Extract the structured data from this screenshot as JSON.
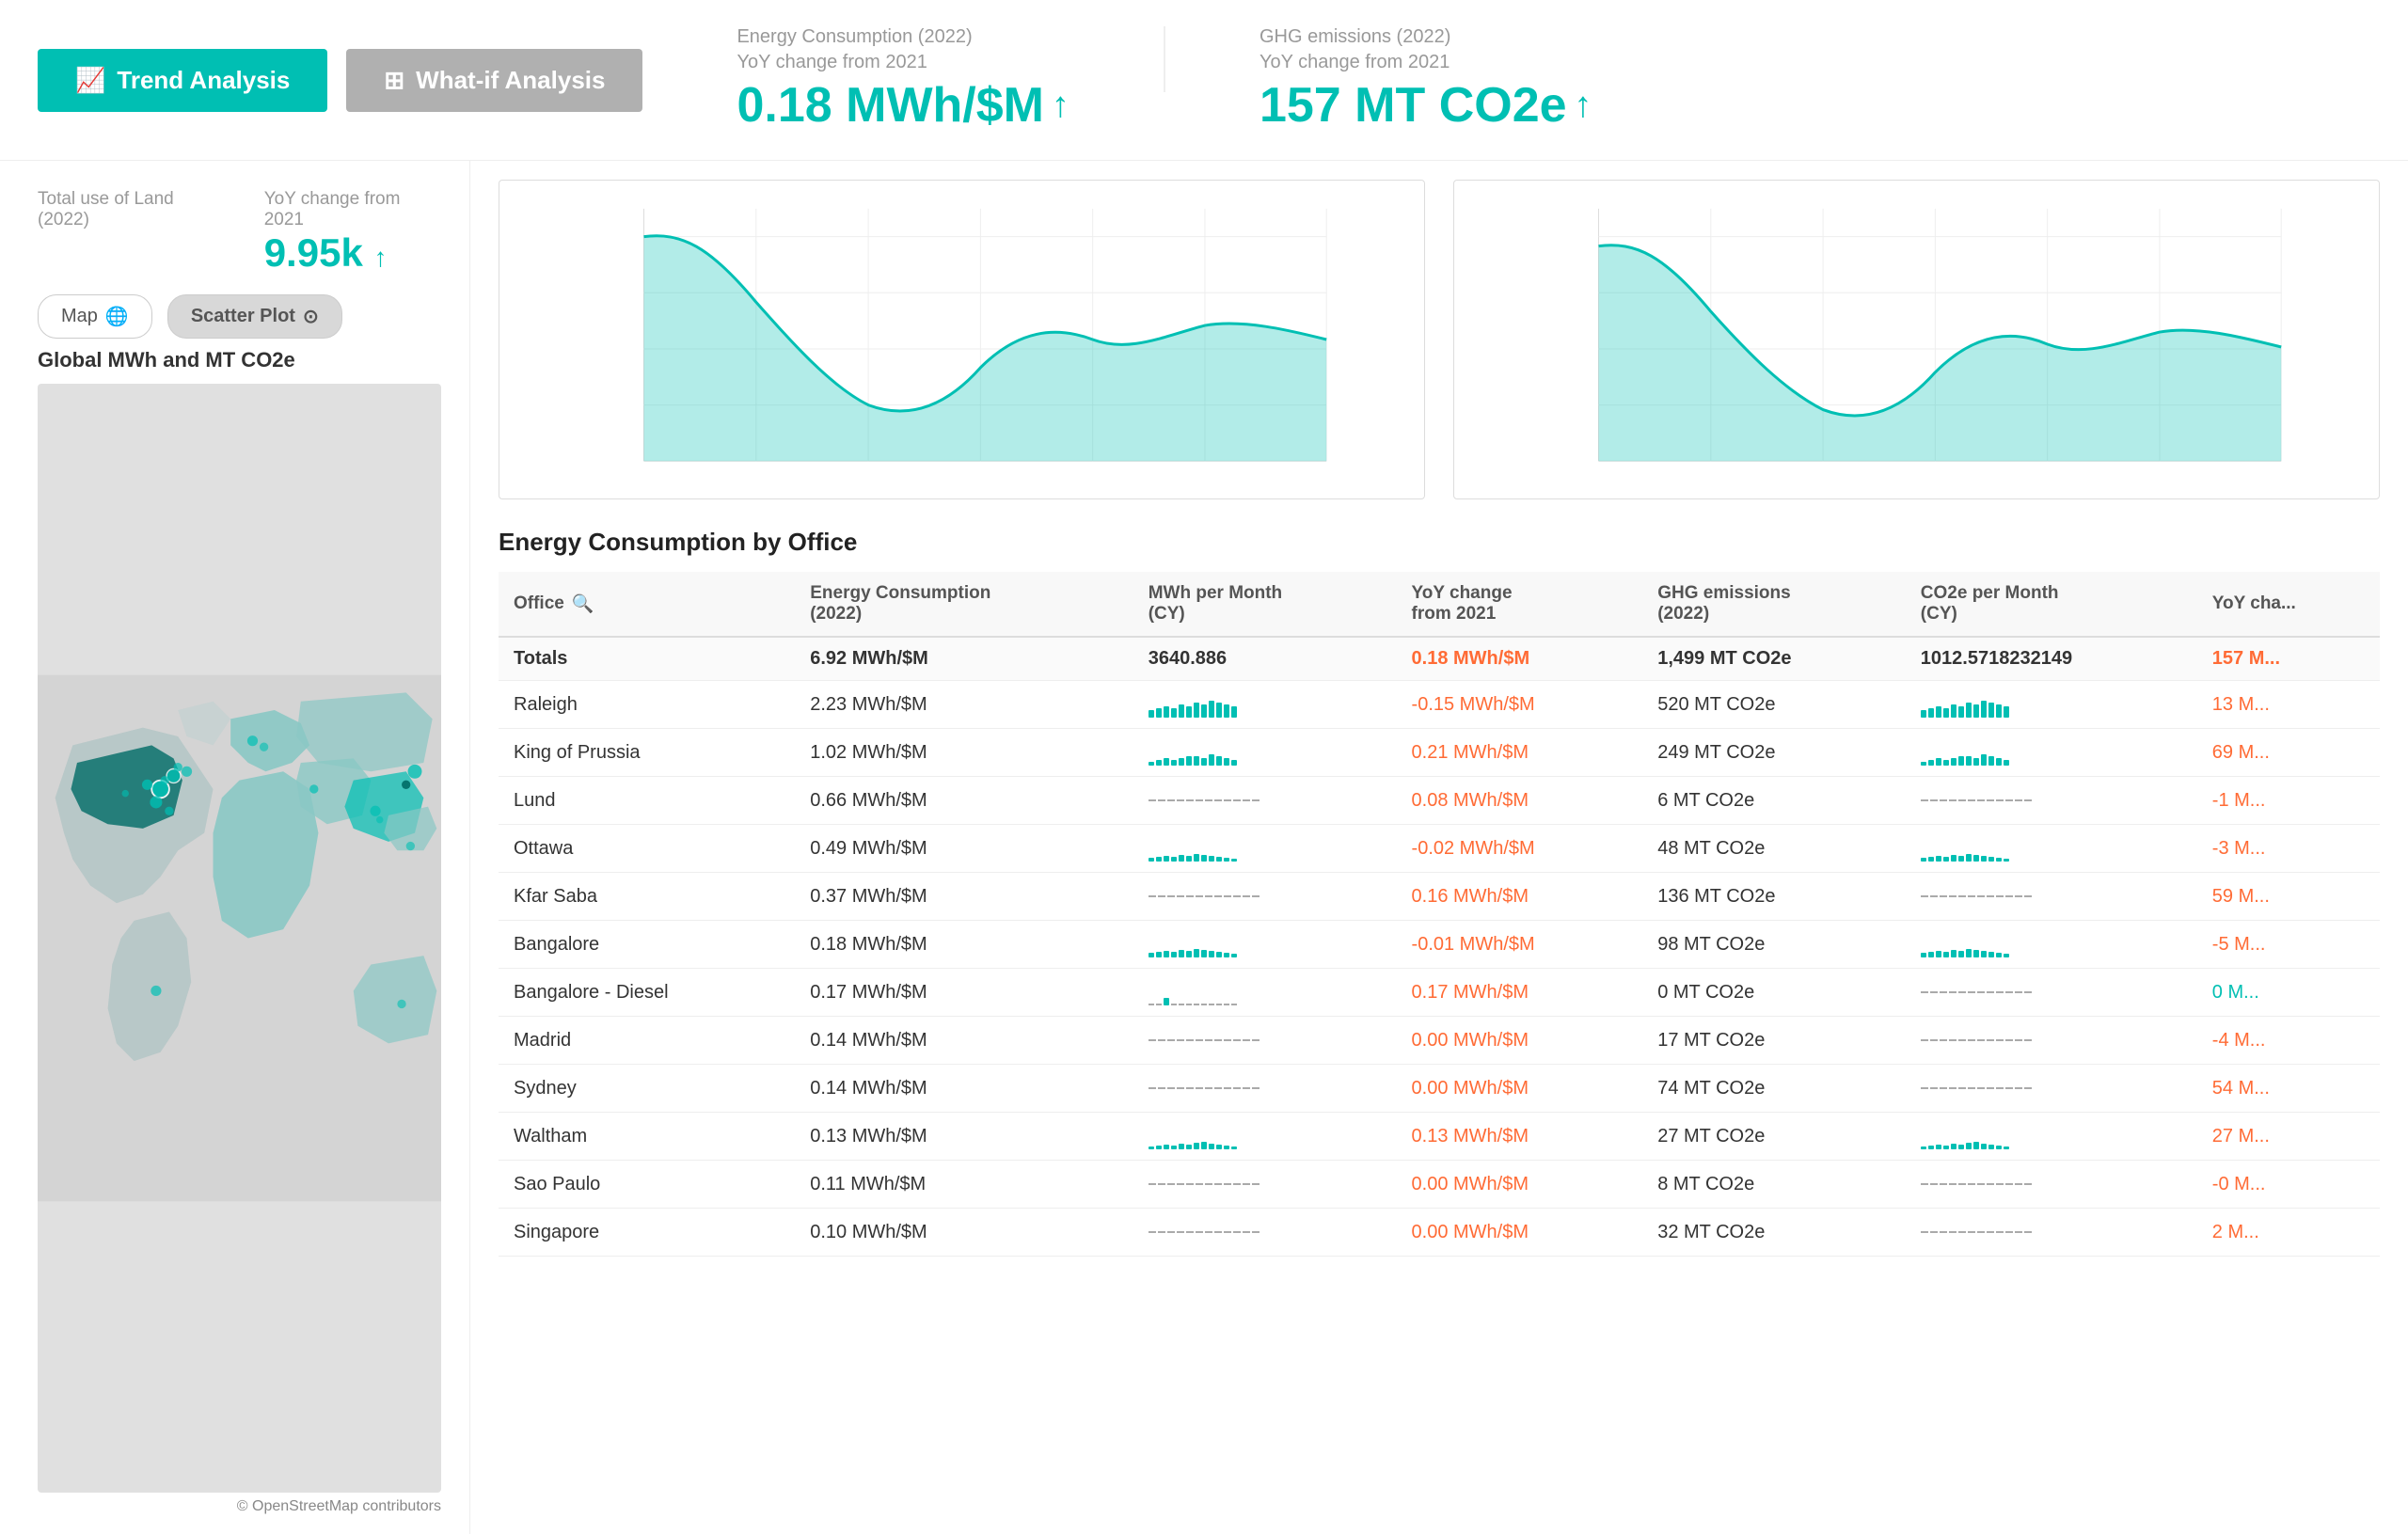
{
  "tabs": [
    {
      "id": "trend",
      "label": "Trend Analysis",
      "icon": "📈",
      "active": true
    },
    {
      "id": "whatif",
      "label": "What-if Analysis",
      "icon": "⊞",
      "active": false
    }
  ],
  "kpis": [
    {
      "label": "Energy Consumption (2022)",
      "sublabel": "YoY change from 2021",
      "value": "0.18 MWh/$M",
      "arrow": "↑"
    },
    {
      "label": "GHG emissions (2022)",
      "sublabel": "YoY change from 2021",
      "value": "157 MT CO2e",
      "arrow": "↑"
    }
  ],
  "land": {
    "label": "Total use of Land (2022)",
    "yoy_label": "YoY change from 2021",
    "value": "9.95k",
    "arrow": "↑"
  },
  "map": {
    "label": "Map",
    "scatter_label": "Scatter Plot",
    "chart_title": "Global MWh and MT CO2e",
    "credit": "© OpenStreetMap contributors"
  },
  "energy_table": {
    "title": "Energy Consumption by Office",
    "columns": [
      "Office",
      "",
      "Energy Consumption (2022)",
      "MWh per Month (CY)",
      "YoY change from 2021",
      "GHG emissions (2022)",
      "CO2e per Month (CY)",
      "YoY cha..."
    ],
    "totals": {
      "office": "Totals",
      "energy": "6.92 MWh/$M",
      "mwh_month": "3640.886",
      "yoy_energy": "0.18 MWh/$M",
      "ghg": "1,499 MT CO2e",
      "co2e_month": "1012.5718232149",
      "yoy_ghg": "157 M..."
    },
    "rows": [
      {
        "office": "Raleigh",
        "energy": "2.23 MWh/$M",
        "bar_type": "solid",
        "bar_heights": [
          8,
          10,
          12,
          10,
          14,
          12,
          16,
          14,
          18,
          16,
          14,
          12
        ],
        "yoy_energy": "-0.15 MWh/$M",
        "yoy_energy_color": "orange",
        "ghg": "520 MT CO2e",
        "bar2_type": "solid",
        "bar2_heights": [
          8,
          10,
          12,
          10,
          14,
          12,
          16,
          14,
          18,
          16,
          14,
          12
        ],
        "yoy_ghg": "13 M...",
        "yoy_ghg_color": "orange"
      },
      {
        "office": "King of Prussia",
        "energy": "1.02 MWh/$M",
        "bar_type": "solid",
        "bar_heights": [
          4,
          6,
          8,
          6,
          8,
          10,
          10,
          8,
          12,
          10,
          8,
          6
        ],
        "yoy_energy": "0.21 MWh/$M",
        "yoy_energy_color": "orange",
        "ghg": "249 MT CO2e",
        "bar2_type": "solid",
        "bar2_heights": [
          4,
          6,
          8,
          6,
          8,
          10,
          10,
          8,
          12,
          10,
          8,
          6
        ],
        "yoy_ghg": "69 M...",
        "yoy_ghg_color": "orange"
      },
      {
        "office": "Lund",
        "energy": "0.66 MWh/$M",
        "bar_type": "dashed",
        "yoy_energy": "0.08 MWh/$M",
        "yoy_energy_color": "orange",
        "ghg": "6 MT CO2e",
        "bar2_type": "dashed",
        "yoy_ghg": "-1 M...",
        "yoy_ghg_color": "orange"
      },
      {
        "office": "Ottawa",
        "energy": "0.49 MWh/$M",
        "bar_type": "solid",
        "bar_heights": [
          4,
          5,
          6,
          5,
          7,
          6,
          8,
          7,
          6,
          5,
          4,
          3
        ],
        "yoy_energy": "-0.02 MWh/$M",
        "yoy_energy_color": "orange",
        "ghg": "48 MT CO2e",
        "bar2_type": "solid",
        "bar2_heights": [
          4,
          5,
          6,
          5,
          7,
          6,
          8,
          7,
          6,
          5,
          4,
          3
        ],
        "yoy_ghg": "-3 M...",
        "yoy_ghg_color": "orange"
      },
      {
        "office": "Kfar Saba",
        "energy": "0.37 MWh/$M",
        "bar_type": "dashed",
        "yoy_energy": "0.16 MWh/$M",
        "yoy_energy_color": "orange",
        "ghg": "136 MT CO2e",
        "bar2_type": "dashed",
        "yoy_ghg": "59 M...",
        "yoy_ghg_color": "orange"
      },
      {
        "office": "Bangalore",
        "energy": "0.18 MWh/$M",
        "bar_type": "solid",
        "bar_heights": [
          5,
          6,
          7,
          6,
          8,
          7,
          9,
          8,
          7,
          6,
          5,
          4
        ],
        "yoy_energy": "-0.01 MWh/$M",
        "yoy_energy_color": "orange",
        "ghg": "98 MT CO2e",
        "bar2_type": "solid",
        "bar2_heights": [
          5,
          6,
          7,
          6,
          8,
          7,
          9,
          8,
          7,
          6,
          5,
          4
        ],
        "yoy_ghg": "-5 M...",
        "yoy_ghg_color": "orange"
      },
      {
        "office": "Bangalore - Diesel",
        "energy": "0.17 MWh/$M",
        "bar_type": "mixed",
        "bar_heights": [
          2,
          2,
          8,
          2,
          2,
          2,
          2,
          2,
          2,
          2,
          2,
          2
        ],
        "yoy_energy": "0.17 MWh/$M",
        "yoy_energy_color": "orange",
        "ghg": "0 MT CO2e",
        "bar2_type": "dashed",
        "yoy_ghg": "0 M...",
        "yoy_ghg_color": "teal"
      },
      {
        "office": "Madrid",
        "energy": "0.14 MWh/$M",
        "bar_type": "dashed",
        "yoy_energy": "0.00 MWh/$M",
        "yoy_energy_color": "orange",
        "ghg": "17 MT CO2e",
        "bar2_type": "dashed",
        "yoy_ghg": "-4 M...",
        "yoy_ghg_color": "orange"
      },
      {
        "office": "Sydney",
        "energy": "0.14 MWh/$M",
        "bar_type": "dashed",
        "yoy_energy": "0.00 MWh/$M",
        "yoy_energy_color": "orange",
        "ghg": "74 MT CO2e",
        "bar2_type": "dashed",
        "yoy_ghg": "54 M...",
        "yoy_ghg_color": "orange"
      },
      {
        "office": "Waltham",
        "energy": "0.13 MWh/$M",
        "bar_type": "solid",
        "bar_heights": [
          3,
          4,
          5,
          4,
          6,
          5,
          7,
          8,
          6,
          5,
          4,
          3
        ],
        "yoy_energy": "0.13 MWh/$M",
        "yoy_energy_color": "orange",
        "ghg": "27 MT CO2e",
        "bar2_type": "solid",
        "bar2_heights": [
          3,
          4,
          5,
          4,
          6,
          5,
          7,
          8,
          6,
          5,
          4,
          3
        ],
        "yoy_ghg": "27 M...",
        "yoy_ghg_color": "orange"
      },
      {
        "office": "Sao Paulo",
        "energy": "0.11 MWh/$M",
        "bar_type": "dashed",
        "yoy_energy": "0.00 MWh/$M",
        "yoy_energy_color": "orange",
        "ghg": "8 MT CO2e",
        "bar2_type": "dashed",
        "yoy_ghg": "-0 M...",
        "yoy_ghg_color": "orange"
      },
      {
        "office": "Singapore",
        "energy": "0.10 MWh/$M",
        "bar_type": "dashed",
        "yoy_energy": "0.00 MWh/$M",
        "yoy_energy_color": "orange",
        "ghg": "32 MT CO2e",
        "bar2_type": "dashed",
        "yoy_ghg": "2 M...",
        "yoy_ghg_color": "orange"
      }
    ]
  },
  "colors": {
    "teal": "#00bfb3",
    "orange": "#ff6b35",
    "gray_inactive": "#b0b0b0"
  }
}
